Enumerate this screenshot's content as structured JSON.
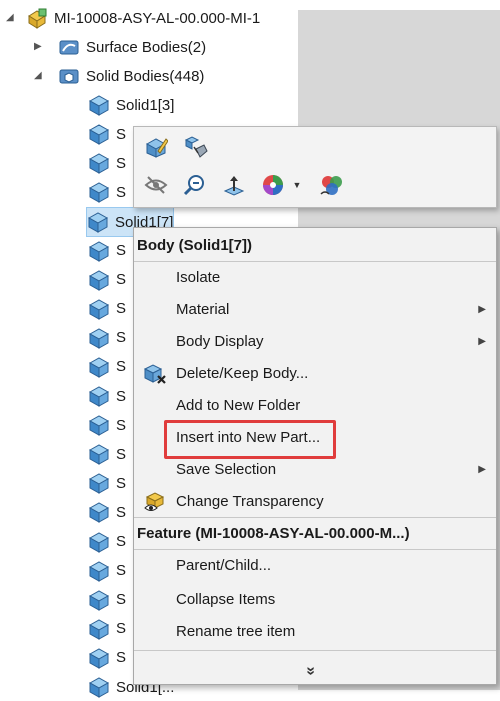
{
  "tree": {
    "root_label": "MI-10008-ASY-AL-00.000-MI-1",
    "surface_bodies_label": "Surface Bodies(2)",
    "solid_bodies_label": "Solid Bodies(448)",
    "body_items": [
      "Solid1[3]",
      "S",
      "S",
      "S",
      "Solid1[7]",
      "S",
      "S",
      "S",
      "S",
      "S",
      "S",
      "S",
      "S",
      "S",
      "S",
      "S",
      "S",
      "S",
      "S",
      "S",
      "Solid1[..."
    ]
  },
  "context_menu": {
    "body_header": "Body (Solid1[7])",
    "items": [
      {
        "label": "Isolate",
        "submenu": false
      },
      {
        "label": "Material",
        "submenu": true
      },
      {
        "label": "Body Display",
        "submenu": true
      },
      {
        "label": "Delete/Keep Body...",
        "submenu": false,
        "icon": "delete-body-icon"
      },
      {
        "label": "Add to New Folder",
        "submenu": false
      },
      {
        "label": "Insert into New Part...",
        "submenu": false
      },
      {
        "label": "Save Selection",
        "submenu": true
      },
      {
        "label": "Change Transparency",
        "submenu": false,
        "icon": "transparency-icon"
      }
    ],
    "feature_header": "Feature (MI-10008-ASY-AL-00.000-M...)",
    "feature_items": [
      {
        "label": "Parent/Child..."
      },
      {
        "label": "Collapse Items"
      },
      {
        "label": "Rename tree item"
      }
    ],
    "more_glyph": "»"
  },
  "toolbar": {
    "icons": [
      "edit-part-icon",
      "move-copy-icon",
      "hide-icon",
      "zoom-to-selection-icon",
      "normal-to-icon",
      "appearance-icon",
      "dropdown-arrow-icon",
      "color-palette-icon"
    ]
  },
  "colors": {
    "highlight_border": "#e03c3c",
    "selection_bg": "#cce4f7",
    "menu_bg": "#f2f2f2"
  }
}
